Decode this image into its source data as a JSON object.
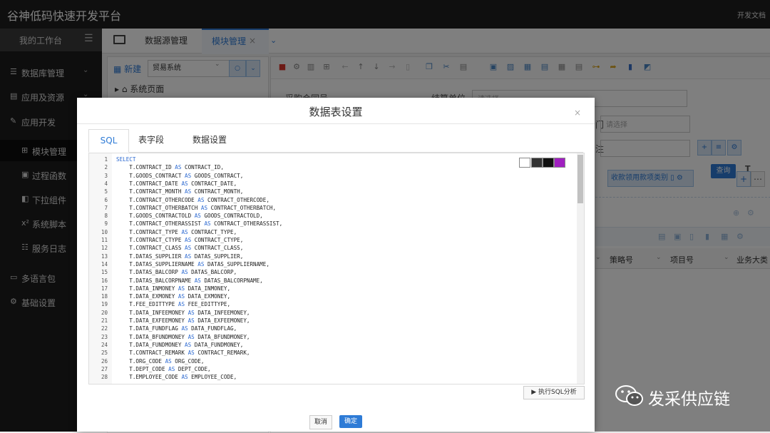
{
  "topbar": {
    "title": "谷神低码快速开发平台",
    "docs": "开发文档"
  },
  "sidebar": {
    "workspace": "我的工作台",
    "items": [
      {
        "label": "数据库管理",
        "icon": "database-icon",
        "glyph": "☰",
        "chevron": "⌄"
      },
      {
        "label": "应用及资源",
        "icon": "stack-icon",
        "glyph": "▤",
        "chevron": "⌄"
      },
      {
        "label": "应用开发",
        "icon": "edit-icon",
        "glyph": "✎",
        "chevron": ""
      },
      {
        "label": "模块管理",
        "icon": "sitemap-icon",
        "glyph": "⊞",
        "chevron": ""
      },
      {
        "label": "过程函数",
        "icon": "function-icon",
        "glyph": "▣",
        "chevron": ""
      },
      {
        "label": "下拉组件",
        "icon": "dropdown-icon",
        "glyph": "◧",
        "chevron": ""
      },
      {
        "label": "系统脚本",
        "icon": "superscript-icon",
        "glyph": "x²",
        "chevron": ""
      },
      {
        "label": "服务日志",
        "icon": "list-icon",
        "glyph": "☷",
        "chevron": ""
      },
      {
        "label": "多语言包",
        "icon": "comment-icon",
        "glyph": "▭",
        "chevron": ""
      },
      {
        "label": "基础设置",
        "icon": "gear-icon",
        "glyph": "⚙",
        "chevron": ""
      }
    ]
  },
  "tabs": {
    "datasource": "数据源管理",
    "module": "模块管理",
    "close": "×",
    "more": "⌄"
  },
  "leftpanel": {
    "new_label": "新建",
    "system_select": "贸易系统",
    "tree_item": "系统页面"
  },
  "rightpanel": {
    "label1": "采购合同号",
    "label2": "结算单位",
    "placeholder1": "请选择",
    "placeholder2": "请选择",
    "dept_label": "门",
    "note_label": "注",
    "search": "查询",
    "tag": "收款领用款项类别",
    "grid_headers": [
      "策略号",
      "项目号",
      "业务大类"
    ]
  },
  "modal": {
    "title": "数据表设置",
    "close": "×",
    "tabs": [
      "SQL",
      "表字段",
      "数据设置"
    ],
    "sql_lines": [
      "SELECT",
      "    T.CONTRACT_ID AS CONTRACT_ID,",
      "    T.GOODS_CONTRACT AS GOODS_CONTRACT,",
      "    T.CONTRACT_DATE AS CONTRACT_DATE,",
      "    T.CONTRACT_MONTH AS CONTRACT_MONTH,",
      "    T.CONTRACT_OTHERCODE AS CONTRACT_OTHERCODE,",
      "    T.CONTRACT_OTHERBATCH AS CONTRACT_OTHERBATCH,",
      "    T.GOODS_CONTRACTOLD AS GOODS_CONTRACTOLD,",
      "    T.CONTRACT_OTHERASSIST AS CONTRACT_OTHERASSIST,",
      "    T.CONTRACT_TYPE AS CONTRACT_TYPE,",
      "    T.CONTRACT_CTYPE AS CONTRACT_CTYPE,",
      "    T.CONTRACT_CLASS AS CONTRACT_CLASS,",
      "    T.DATAS_SUPPLIER AS DATAS_SUPPLIER,",
      "    T.DATAS_SUPPLIERNAME AS DATAS_SUPPLIERNAME,",
      "    T.DATAS_BALCORP AS DATAS_BALCORP,",
      "    T.DATAS_BALCORPNAME AS DATAS_BALCORPNAME,",
      "    T.DATA_INMONEY AS DATA_INMONEY,",
      "    T.DATA_EXMONEY AS DATA_EXMONEY,",
      "    T.FEE_EDITTYPE AS FEE_EDITTYPE,",
      "    T.DATA_INFEEMONEY AS DATA_INFEEMONEY,",
      "    T.DATA_EXFEEMONEY AS DATA_EXFEEMONEY,",
      "    T.DATA_FUNDFLAG AS DATA_FUNDFLAG,",
      "    T.DATA_BFUNDMONEY AS DATA_BFUNDMONEY,",
      "    T.DATA_FUNDMONEY AS DATA_FUNDMONEY,",
      "    T.CONTRACT_REMARK AS CONTRACT_REMARK,",
      "    T.ORG_CODE AS ORG_CODE,",
      "    T.DEPT_CODE AS DEPT_CODE,",
      "    T.EMPLOYEE_CODE AS EMPLOYEE_CODE,"
    ],
    "theme_swatches": [
      "#ffffff",
      "#333333",
      "#111111",
      "#a020c0"
    ],
    "analyze_button": "▶ 执行SQL分析",
    "cancel_button": "取消",
    "ok_button": "确定"
  },
  "watermark": {
    "text": "发采供应链",
    "icon": "wechat-icon"
  },
  "colors": {
    "accent": "#2e7bd6",
    "topbar": "#1f1f1f",
    "sidebar": "#1c1c1c",
    "keyword": "#2d6ad1"
  }
}
